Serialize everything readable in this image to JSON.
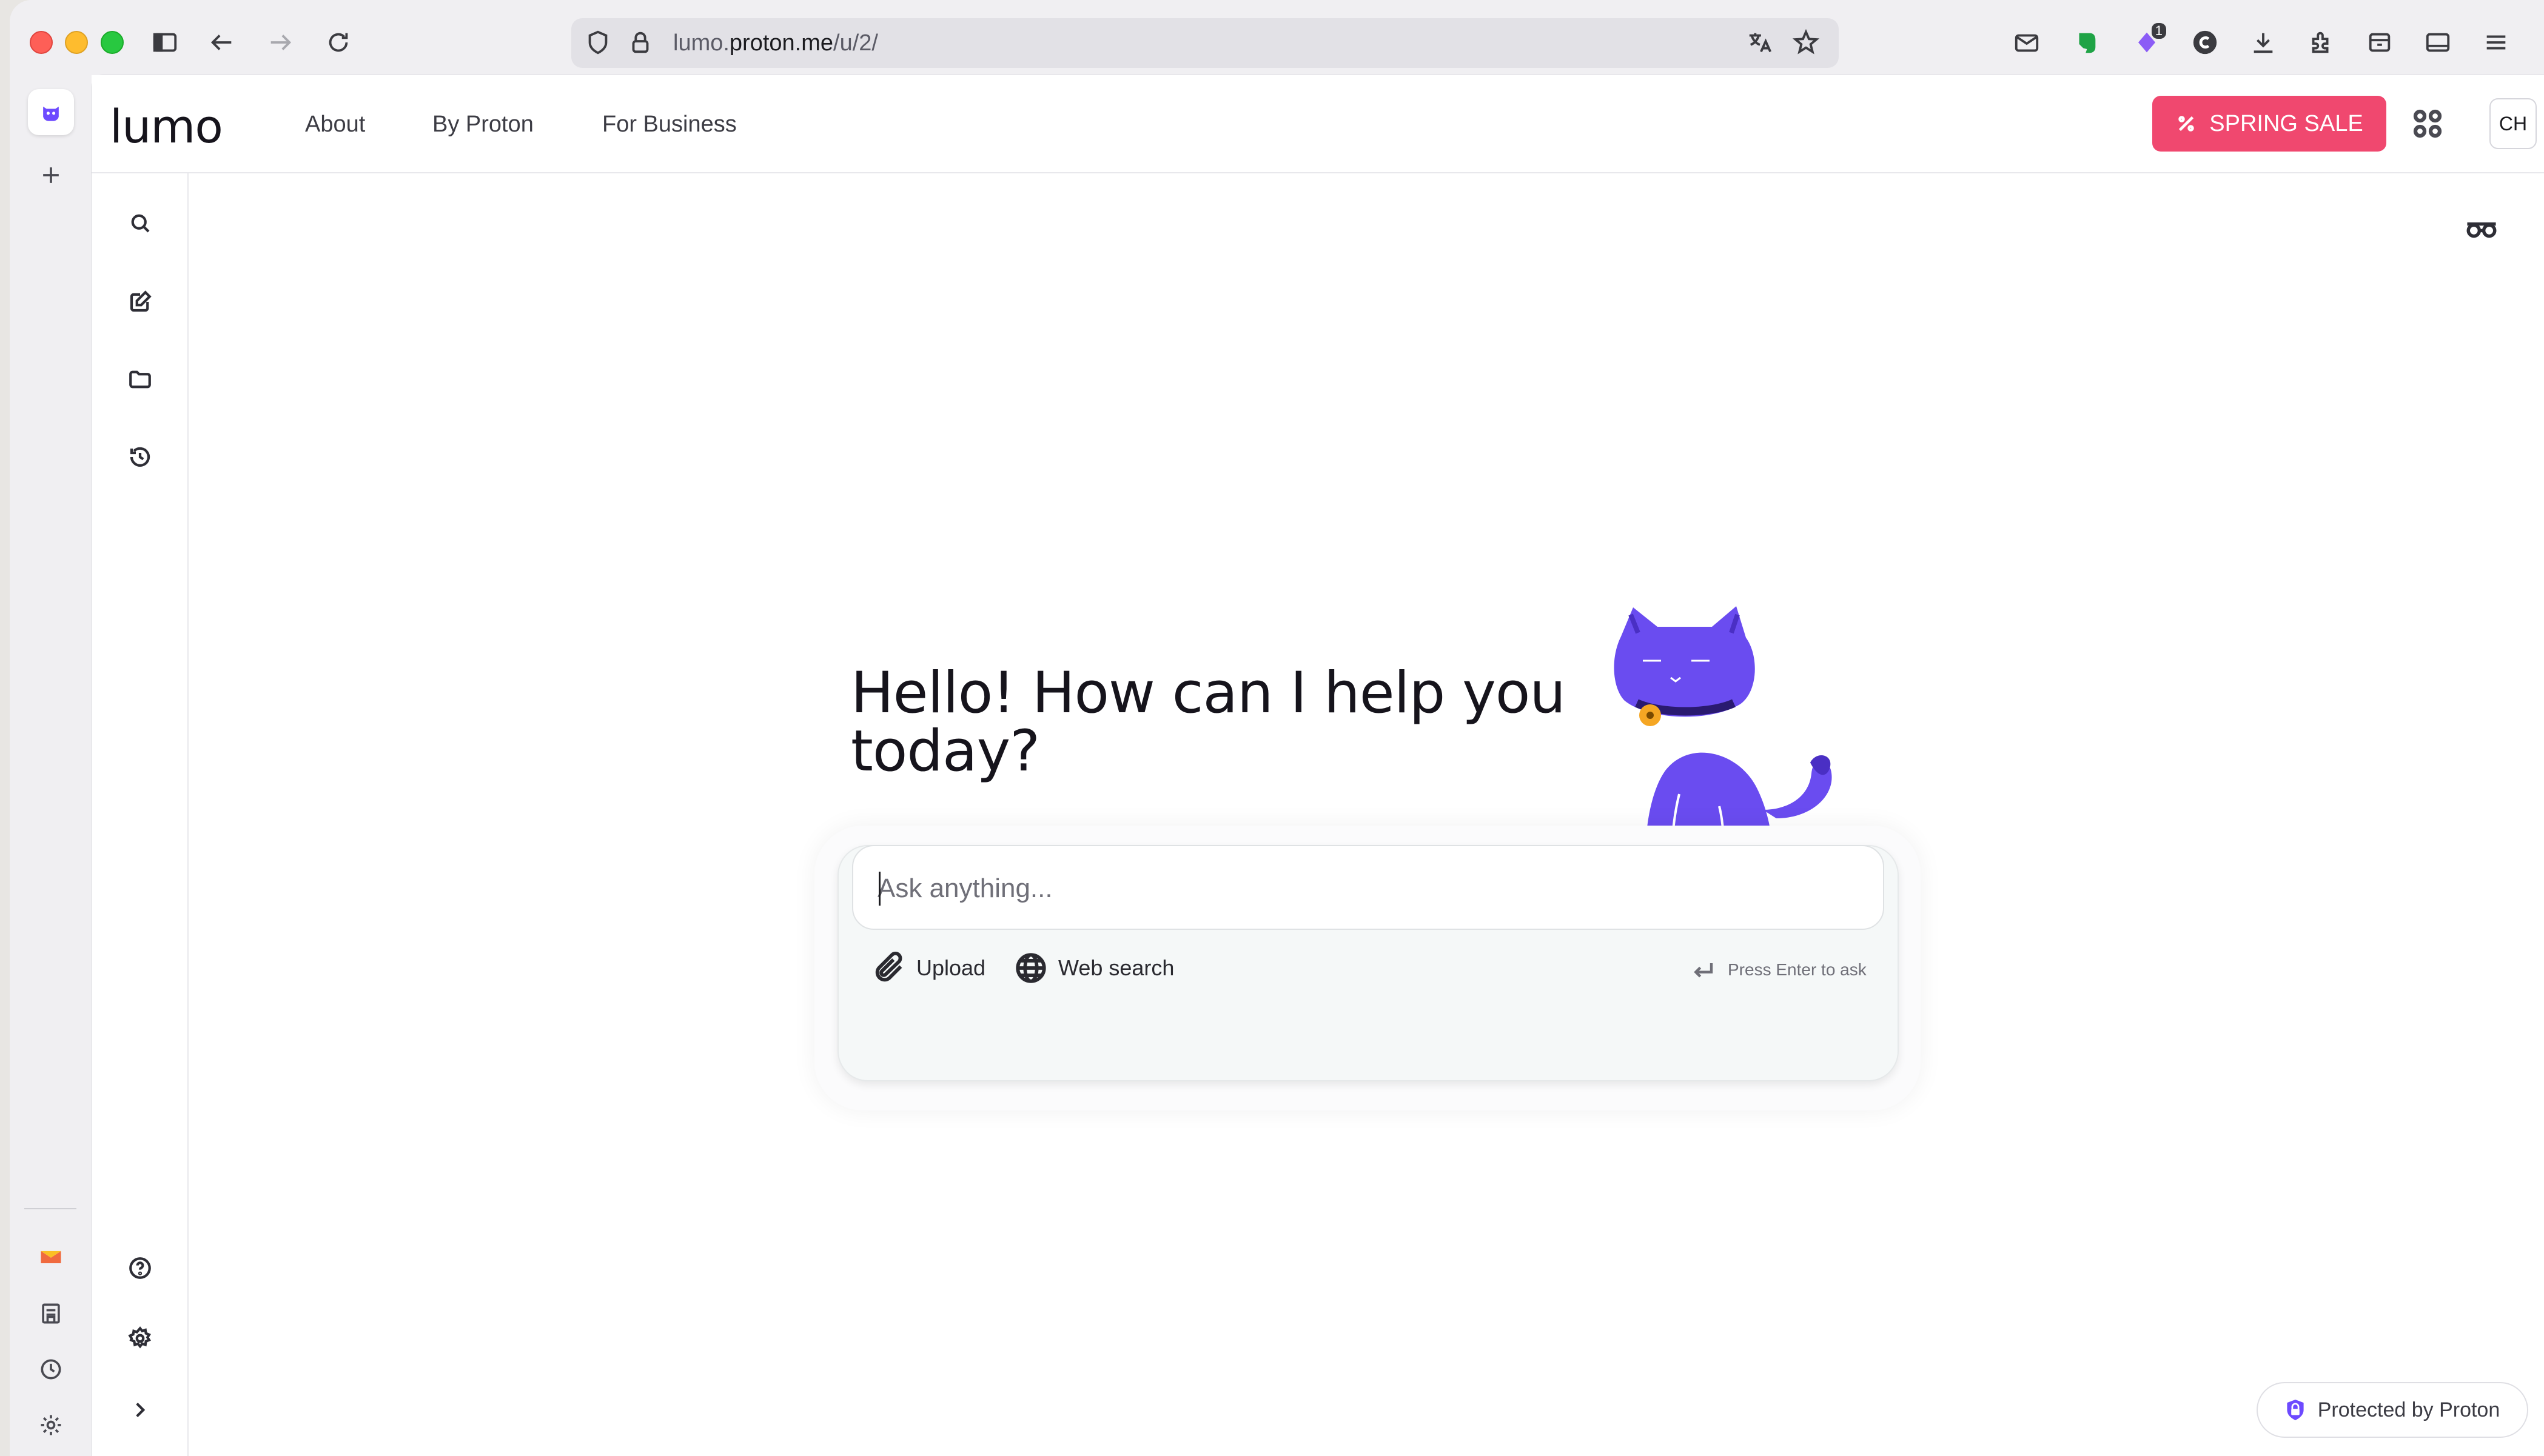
{
  "browser": {
    "url_domain_prefix": "lumo.",
    "url_domain_main": "proton.me",
    "url_path": "/u/2/",
    "extension_badge": "1"
  },
  "header": {
    "logo": "lumo",
    "nav": [
      {
        "label": "About"
      },
      {
        "label": "By Proton"
      },
      {
        "label": "For Business"
      }
    ],
    "sale_button": "SPRING SALE",
    "avatar_initials": "CH"
  },
  "colors": {
    "sale": "#f0486f",
    "cat": "#6a4cf0",
    "accent": "#6d4aff"
  },
  "main": {
    "greeting": "Hello! How can I help you today?",
    "composer": {
      "placeholder": "Ask anything...",
      "upload_label": "Upload",
      "web_search_label": "Web search",
      "hint": "Press Enter to ask"
    }
  },
  "footer": {
    "protected_label": "Protected by Proton"
  },
  "icons": {
    "sidebar_top": [
      "search-icon",
      "new-chat-icon",
      "folder-icon",
      "history-icon"
    ],
    "sidebar_bottom": [
      "help-icon",
      "settings-icon",
      "expand-icon"
    ],
    "rail": [
      "lumo-app-icon",
      "add-icon",
      "mail-icon",
      "drive-icon",
      "clock-icon",
      "gear-icon"
    ]
  }
}
